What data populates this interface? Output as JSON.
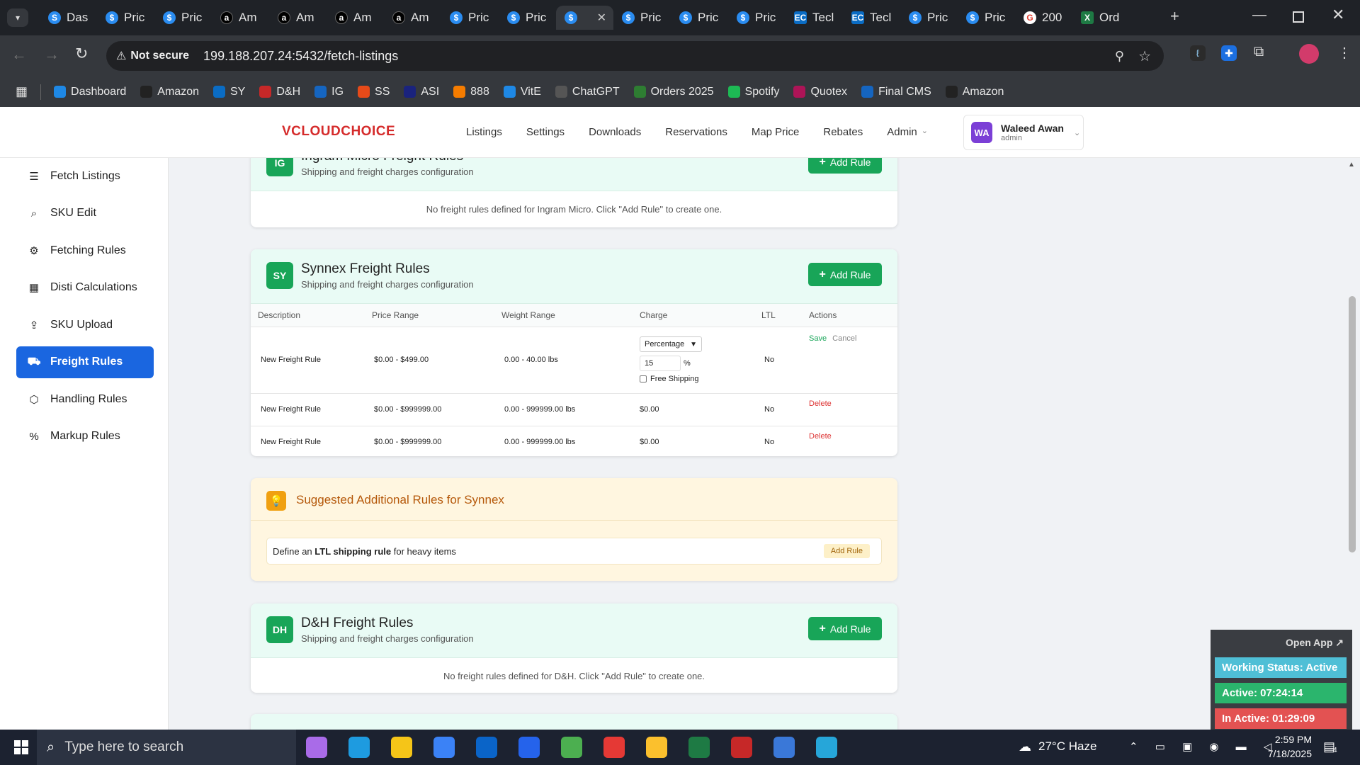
{
  "browser": {
    "tabs": [
      {
        "label": "Das",
        "icon": "blue-s-icon"
      },
      {
        "label": "Pric",
        "icon": "dollar-icon"
      },
      {
        "label": "Pric",
        "icon": "dollar-icon"
      },
      {
        "label": "Am",
        "icon": "amazon-icon"
      },
      {
        "label": "Am",
        "icon": "amazon-icon"
      },
      {
        "label": "Am",
        "icon": "amazon-icon"
      },
      {
        "label": "Am",
        "icon": "amazon-icon"
      },
      {
        "label": "Pric",
        "icon": "dollar-icon"
      },
      {
        "label": "Pric",
        "icon": "dollar-icon"
      },
      {
        "label": "",
        "icon": "dollar-icon",
        "active": true
      },
      {
        "label": "Pric",
        "icon": "dollar-icon"
      },
      {
        "label": "Pric",
        "icon": "dollar-icon"
      },
      {
        "label": "Pric",
        "icon": "dollar-icon"
      },
      {
        "label": "Tecl",
        "icon": "ec-icon"
      },
      {
        "label": "Tecl",
        "icon": "ec-icon"
      },
      {
        "label": "Pric",
        "icon": "dollar-icon"
      },
      {
        "label": "Pric",
        "icon": "dollar-icon"
      },
      {
        "label": "200",
        "icon": "google-icon"
      },
      {
        "label": "Ord",
        "icon": "excel-icon"
      }
    ],
    "security_label": "Not secure",
    "url": "199.188.207.24:5432/fetch-listings",
    "bookmarks": [
      "Dashboard",
      "Amazon",
      "SY",
      "D&H",
      "IG",
      "SS",
      "ASI",
      "888",
      "VitE",
      "ChatGPT",
      "Orders 2025",
      "Spotify",
      "Quotex",
      "Final CMS",
      "Amazon"
    ]
  },
  "app": {
    "logo": "VCLOUDCHOICE",
    "nav": [
      "Listings",
      "Settings",
      "Downloads",
      "Reservations",
      "Map Price",
      "Rebates",
      "Admin"
    ],
    "user": {
      "initials": "WA",
      "name": "Waleed Awan",
      "role": "admin"
    }
  },
  "sidebar": [
    {
      "label": "Fetch Listings",
      "icon": "list-icon"
    },
    {
      "label": "SKU Edit",
      "icon": "search-icon"
    },
    {
      "label": "Fetching Rules",
      "icon": "gear-icon"
    },
    {
      "label": "Disti Calculations",
      "icon": "calculator-icon"
    },
    {
      "label": "SKU Upload",
      "icon": "upload-icon"
    },
    {
      "label": "Freight Rules",
      "icon": "truck-icon",
      "active": true
    },
    {
      "label": "Handling Rules",
      "icon": "box-icon"
    },
    {
      "label": "Markup Rules",
      "icon": "percent-icon"
    }
  ],
  "ingram": {
    "badge": "IG",
    "title": "Ingram Micro Freight Rules",
    "subtitle": "Shipping and freight charges configuration",
    "add_label": "Add Rule",
    "empty": "No freight rules defined for Ingram Micro. Click \"Add Rule\" to create one."
  },
  "synnex": {
    "badge": "SY",
    "title": "Synnex Freight Rules",
    "subtitle": "Shipping and freight charges configuration",
    "add_label": "Add Rule",
    "columns": [
      "Description",
      "Price Range",
      "Weight Range",
      "Charge",
      "LTL",
      "Actions"
    ],
    "edit_row": {
      "description": "New Freight Rule",
      "price_range": "$0.00 - $499.00",
      "weight_range": "0.00 - 40.00 lbs",
      "charge_type": "Percentage",
      "charge_value": "15",
      "charge_unit": "%",
      "free_shipping_label": "Free Shipping",
      "ltl": "No",
      "save": "Save",
      "cancel": "Cancel"
    },
    "rows": [
      {
        "description": "New Freight Rule",
        "price_range": "$0.00 - $999999.00",
        "weight_range": "0.00 - 999999.00 lbs",
        "charge": "$0.00",
        "ltl": "No",
        "action": "Delete"
      },
      {
        "description": "New Freight Rule",
        "price_range": "$0.00 - $999999.00",
        "weight_range": "0.00 - 999999.00 lbs",
        "charge": "$0.00",
        "ltl": "No",
        "action": "Delete"
      }
    ]
  },
  "suggestions": {
    "title": "Suggested Additional Rules for Synnex",
    "text_pre": "Define an",
    "text_bold": "LTL shipping rule",
    "text_post": "for heavy items",
    "add_label": "Add Rule"
  },
  "dh": {
    "badge": "DH",
    "title": "D&H Freight Rules",
    "subtitle": "Shipping and freight charges configuration",
    "add_label": "Add Rule",
    "empty": "No freight rules defined for D&H. Click \"Add Rule\" to create one."
  },
  "widget": {
    "open_app": "Open App ↗",
    "working": "Working Status: Active",
    "active": "Active: 07:24:14",
    "inactive": "In Active: 01:29:09"
  },
  "taskbar": {
    "search_placeholder": "Type here to search",
    "weather": "27°C Haze",
    "time": "2:59 PM",
    "date": "7/18/2025",
    "notifications": "4"
  }
}
